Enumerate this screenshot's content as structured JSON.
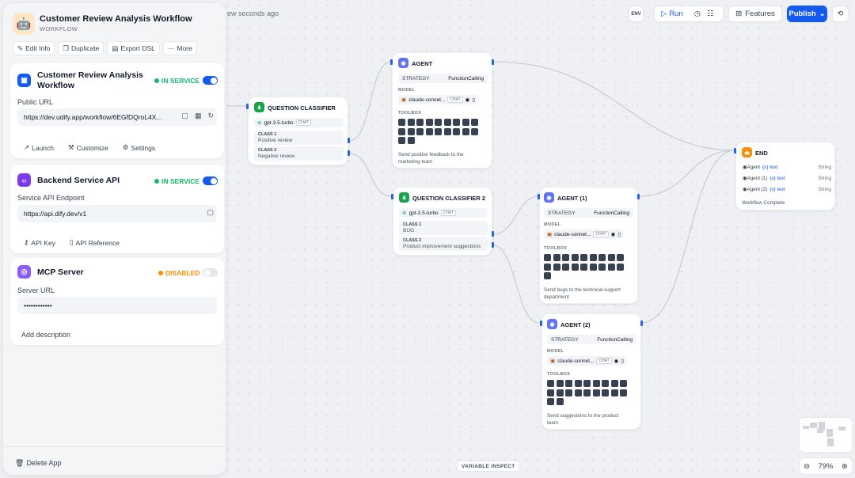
{
  "status_bar": {
    "saved_text": "ew seconds ago"
  },
  "app": {
    "title": "Customer Review Analysis Workflow",
    "type": "WORKFLOW"
  },
  "actions": [
    "Edit Info",
    "Duplicate",
    "Export DSL",
    "More"
  ],
  "webapp": {
    "title": "Customer Review Analysis Workflow",
    "status": "IN SERVICE",
    "url_label": "Public URL",
    "url": "https://dev.udify.app/workflow/6EGfDQroL4X...",
    "links": [
      "Launch",
      "Customize",
      "Settings"
    ]
  },
  "api": {
    "title": "Backend Service API",
    "status": "IN SERVICE",
    "endpoint_label": "Service API Endpoint",
    "endpoint": "https://api.dify.dev/v1",
    "links": [
      "API Key",
      "API Reference"
    ]
  },
  "mcp": {
    "title": "MCP Server",
    "status": "DISABLED",
    "url_label": "Server URL",
    "url": "••••••••••••",
    "description": "Add description"
  },
  "delete_label": "Delete App",
  "topbar": {
    "env": "ENV",
    "run": "Run",
    "features": "Features",
    "publish": "Publish"
  },
  "colors": {
    "accent": "#155aef",
    "success": "#12b76a",
    "warning": "#f79009",
    "agent": "#6172f3",
    "classifier": "#16a34a",
    "end": "#f79009"
  },
  "nodes": {
    "qc1": {
      "title": "QUESTION CLASSIFIER",
      "model": "gpt-3.5-turbo",
      "tag": "CHAT",
      "classes": [
        {
          "label": "CLASS 1",
          "value": "Positive review"
        },
        {
          "label": "CLASS 2",
          "value": "Negative review"
        }
      ]
    },
    "qc2": {
      "title": "QUESTION CLASSIFIER 2",
      "model": "gpt-3.5-turbo",
      "tag": "CHAT",
      "classes": [
        {
          "label": "CLASS 1",
          "value": "BUG"
        },
        {
          "label": "CLASS 2",
          "value": "Product improvement suggestions"
        }
      ]
    },
    "agent": {
      "title": "AGENT",
      "strategy_label": "STRATEGY",
      "strategy": "FunctionCalling",
      "model_label": "MODEL",
      "model": "claude-sonnet...",
      "tag": "CHAT",
      "toolbox_label": "TOOLBOX",
      "desc": [
        "Send positive feedback to the",
        "marketing team"
      ]
    },
    "agent1": {
      "title": "AGENT (1)",
      "strategy_label": "STRATEGY",
      "strategy": "FunctionCalling",
      "model_label": "MODEL",
      "model": "claude-sonnet...",
      "tag": "CHAT",
      "toolbox_label": "TOOLBOX",
      "desc": [
        "Send bugs to the technical support",
        "department"
      ]
    },
    "agent2": {
      "title": "AGENT (2)",
      "strategy_label": "STRATEGY",
      "strategy": "FunctionCalling",
      "model_label": "MODEL",
      "model": "claude-sonnet...",
      "tag": "CHAT",
      "toolbox_label": "TOOLBOX",
      "desc": [
        "Send suggestions to the product",
        "team"
      ]
    },
    "end": {
      "title": "END",
      "outputs": [
        {
          "node": "Agent",
          "var": "{x} text",
          "type": "String"
        },
        {
          "node": "Agent (1)",
          "var": "{x} text",
          "type": "String"
        },
        {
          "node": "Agent (2)",
          "var": "{x} text",
          "type": "String"
        }
      ],
      "desc": "Workflow Complete"
    }
  },
  "variable_inspect": "VARIABLE INSPECT",
  "zoom": "79%"
}
